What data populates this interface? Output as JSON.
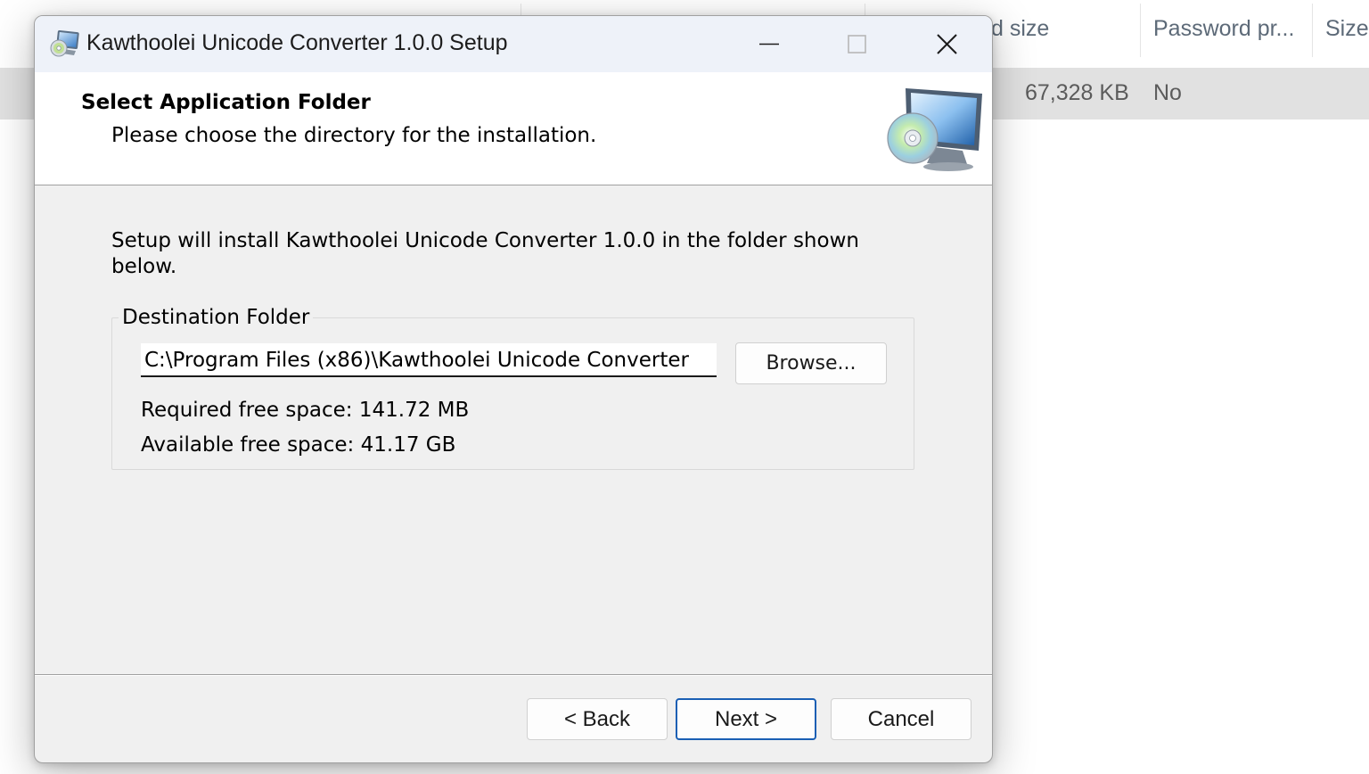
{
  "explorer": {
    "columns": [
      {
        "label": "d size"
      },
      {
        "label": "Password pr..."
      },
      {
        "label": "Size"
      }
    ],
    "row": {
      "compressed_size": "67,328 KB",
      "password_protected": "No"
    }
  },
  "dialog": {
    "title": "Kawthoolei Unicode Converter 1.0.0 Setup",
    "header": {
      "title": "Select Application Folder",
      "subtitle": "Please choose the directory for the installation."
    },
    "body_text": "Setup will install Kawthoolei Unicode Converter 1.0.0 in the folder shown below.",
    "group_label": "Destination Folder",
    "path_value": "C:\\Program Files (x86)\\Kawthoolei Unicode Converter",
    "browse_label": "Browse...",
    "required_space": "Required free space: 141.72 MB",
    "available_space": "Available free space: 41.17 GB",
    "buttons": {
      "back": "< Back",
      "next": "Next >",
      "cancel": "Cancel"
    }
  },
  "icons": {
    "app": "setup-disc-icon",
    "minimize": "minimize-icon",
    "maximize": "maximize-icon",
    "close": "close-icon",
    "header_art": "computer-disc-icon",
    "sort": "sort-ascending-icon"
  },
  "colors": {
    "dialog_bg": "#f0f0f0",
    "titlebar_bg": "#eef2f9",
    "default_button_border": "#1a5fb4",
    "selected_row": "#e1e1e1"
  }
}
